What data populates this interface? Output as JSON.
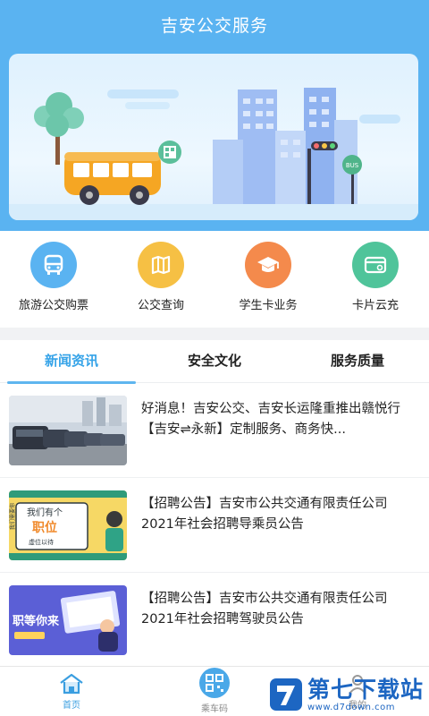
{
  "header": {
    "title": "吉安公交服务"
  },
  "menu": {
    "items": [
      {
        "label": "旅游公交购票",
        "icon": "bus-icon",
        "color": "#5ab3f1"
      },
      {
        "label": "公交查询",
        "icon": "map-icon",
        "color": "#f6c044"
      },
      {
        "label": "学生卡业务",
        "icon": "graduation-cap-icon",
        "color": "#f48a4c"
      },
      {
        "label": "卡片云充",
        "icon": "card-icon",
        "color": "#4fc49a"
      }
    ]
  },
  "tabs": [
    {
      "label": "新闻资讯",
      "active": true
    },
    {
      "label": "安全文化",
      "active": false
    },
    {
      "label": "服务质量",
      "active": false
    }
  ],
  "news": [
    {
      "title": "好消息！吉安公交、吉安长运隆重推出赣悦行【吉安⇌永新】定制服务、商务快..."
    },
    {
      "title": "【招聘公告】吉安市公共交通有限责任公司2021年社会招聘导乘员公告",
      "thumb_text": [
        "我们需要你",
        "我们有个",
        "职位",
        "虚位以待"
      ]
    },
    {
      "title": "【招聘公告】吉安市公共交通有限责任公司2021年社会招聘驾驶员公告",
      "thumb_text": [
        "职等你来"
      ]
    }
  ],
  "bottom_nav": [
    {
      "label": "首页",
      "icon": "home-icon",
      "active": true
    },
    {
      "label": "乘车码",
      "icon": "qr-code-icon",
      "active": false
    },
    {
      "label": "我的",
      "icon": "user-icon",
      "active": false
    }
  ],
  "watermark": {
    "title": "第七下载站",
    "url": "www.d7down.com"
  },
  "colors": {
    "primary": "#5ab3f1",
    "active_tab": "#35a3e8"
  }
}
